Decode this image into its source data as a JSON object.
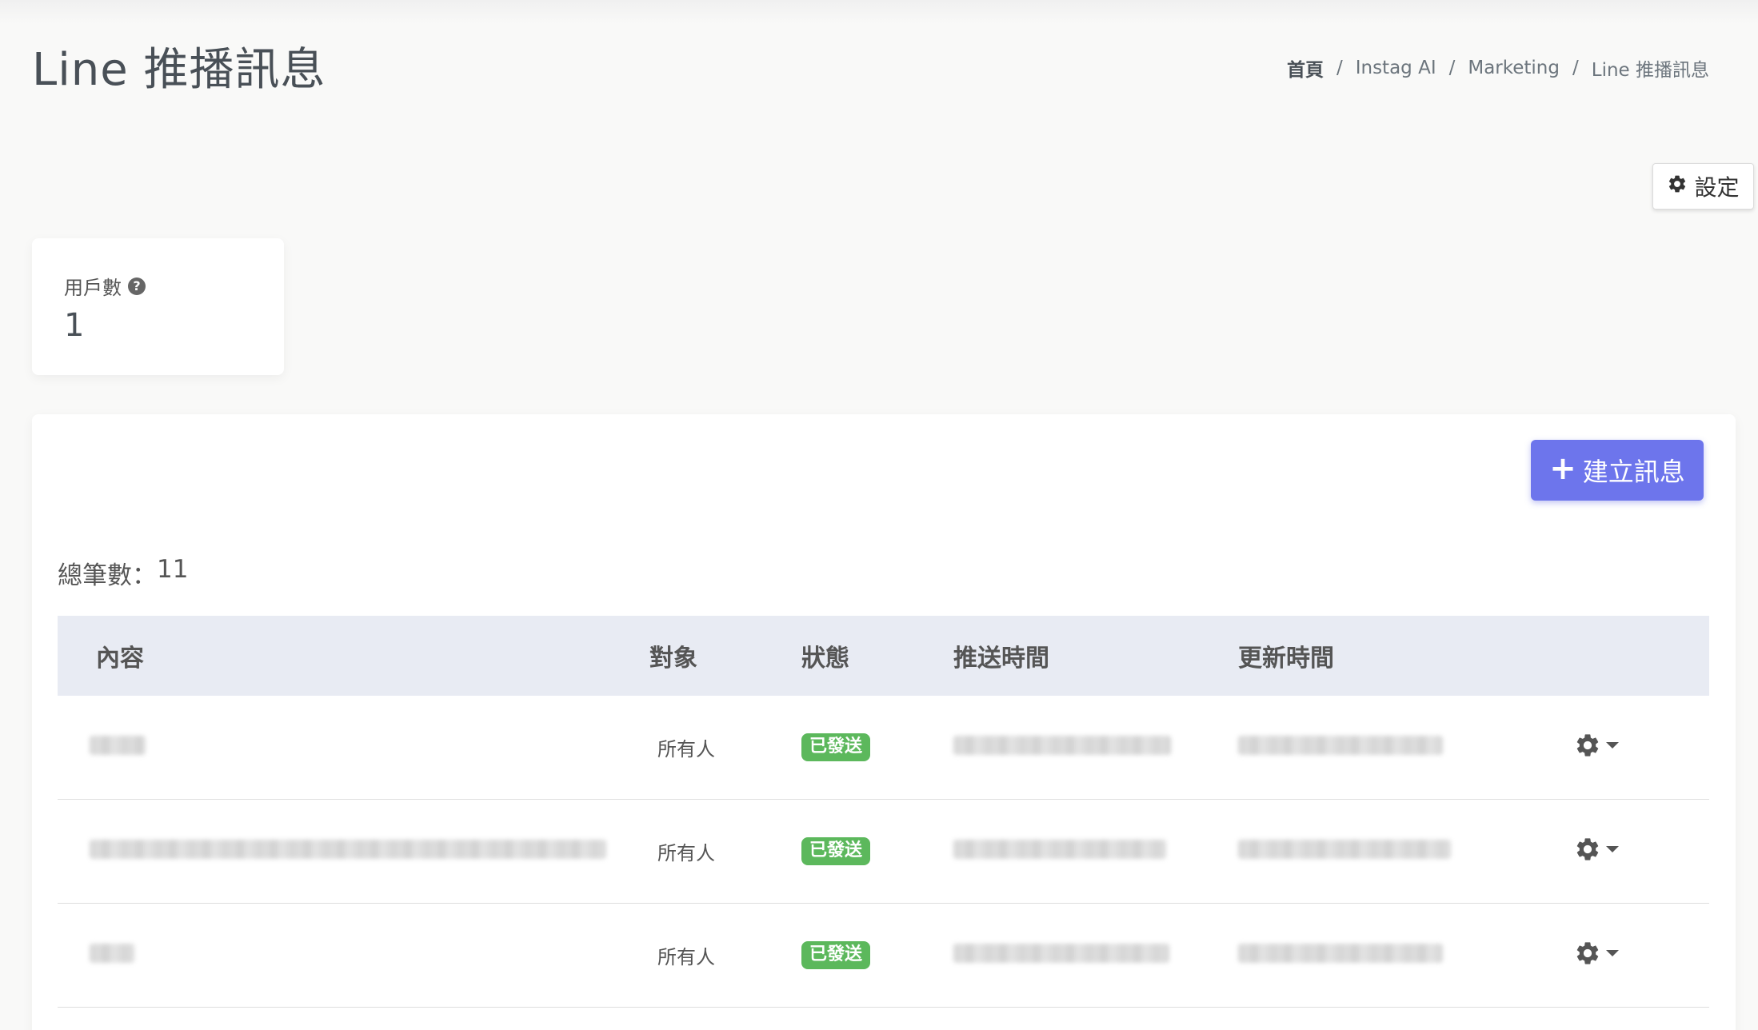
{
  "header": {
    "title": "Line 推播訊息",
    "breadcrumb": {
      "home": "首頁",
      "level1": "Instag AI",
      "level2": "Marketing",
      "current": "Line 推播訊息",
      "separator": "/"
    }
  },
  "settings_button": {
    "label": "設定",
    "icon": "gear-icon"
  },
  "stats": {
    "users_label": "用戶數",
    "users_help_icon": "?",
    "users_value": "1"
  },
  "toolbar": {
    "create_icon": "+",
    "create_label": "建立訊息"
  },
  "table": {
    "total_label": "總筆數：",
    "total_value": "11",
    "columns": [
      "內容",
      "對象",
      "狀態",
      "推送時間",
      "更新時間",
      ""
    ],
    "rows": [
      {
        "content": "",
        "audience": "所有人",
        "status": "已發送",
        "push_time": "",
        "update_time": ""
      },
      {
        "content": "",
        "audience": "所有人",
        "status": "已發送",
        "push_time": "",
        "update_time": ""
      },
      {
        "content": "",
        "audience": "所有人",
        "status": "已發送",
        "push_time": "",
        "update_time": ""
      }
    ]
  },
  "colors": {
    "primary": "#6d75ec",
    "success": "#5cb85c",
    "table_header_bg": "#e8ebf3"
  }
}
